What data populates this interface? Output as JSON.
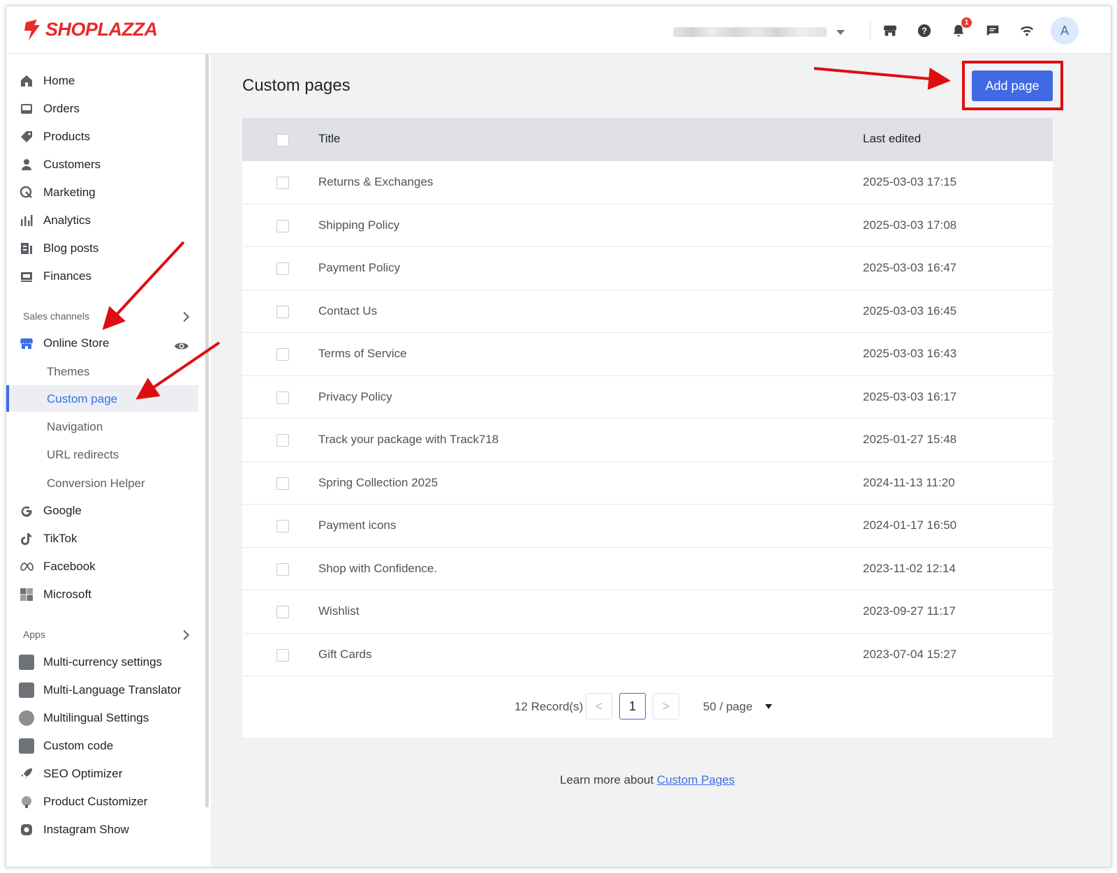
{
  "brand": {
    "name": "SHOPLAZZA",
    "color": "#e8292b"
  },
  "header": {
    "icons": [
      "storefront-icon",
      "help-icon",
      "bell-icon",
      "chat-icon",
      "wifi-icon"
    ],
    "notification_count": "1",
    "avatar_letter": "A"
  },
  "sidebar": {
    "main_items": [
      {
        "label": "Home",
        "icon": "home-icon"
      },
      {
        "label": "Orders",
        "icon": "orders-icon"
      },
      {
        "label": "Products",
        "icon": "tag-icon"
      },
      {
        "label": "Customers",
        "icon": "person-icon"
      },
      {
        "label": "Marketing",
        "icon": "marketing-icon"
      },
      {
        "label": "Analytics",
        "icon": "analytics-icon"
      },
      {
        "label": "Blog posts",
        "icon": "blog-icon"
      },
      {
        "label": "Finances",
        "icon": "finances-icon"
      }
    ],
    "sales_channels_label": "Sales channels",
    "online_store_label": "Online Store",
    "online_store_sub": [
      {
        "label": "Themes"
      },
      {
        "label": "Custom page",
        "active": true
      },
      {
        "label": "Navigation"
      },
      {
        "label": "URL redirects"
      },
      {
        "label": "Conversion Helper"
      }
    ],
    "channels": [
      {
        "label": "Google",
        "icon": "google-icon"
      },
      {
        "label": "TikTok",
        "icon": "tiktok-icon"
      },
      {
        "label": "Facebook",
        "icon": "meta-icon"
      },
      {
        "label": "Microsoft",
        "icon": "microsoft-icon"
      }
    ],
    "apps_label": "Apps",
    "apps": [
      {
        "label": "Multi-currency settings"
      },
      {
        "label": "Multi-Language Translator"
      },
      {
        "label": "Multilingual Settings"
      },
      {
        "label": "Custom code"
      },
      {
        "label": "SEO Optimizer"
      },
      {
        "label": "Product Customizer"
      },
      {
        "label": "Instagram Show"
      }
    ],
    "accent_color": "#3a6fe8"
  },
  "main": {
    "title": "Custom pages",
    "add_button_label": "Add page",
    "table": {
      "columns": [
        "Title",
        "Last edited"
      ],
      "rows": [
        {
          "title": "Returns & Exchanges",
          "edited": "2025-03-03 17:15"
        },
        {
          "title": "Shipping Policy",
          "edited": "2025-03-03 17:08"
        },
        {
          "title": "Payment Policy",
          "edited": "2025-03-03 16:47"
        },
        {
          "title": "Contact Us",
          "edited": "2025-03-03 16:45"
        },
        {
          "title": "Terms of Service",
          "edited": "2025-03-03 16:43"
        },
        {
          "title": "Privacy Policy",
          "edited": "2025-03-03 16:17"
        },
        {
          "title": "Track your package with Track718",
          "edited": "2025-01-27 15:48"
        },
        {
          "title": "Spring Collection 2025",
          "edited": "2024-11-13 11:20"
        },
        {
          "title": "Payment icons",
          "edited": "2024-01-17 16:50"
        },
        {
          "title": "Shop with Confidence.",
          "edited": "2023-11-02 12:14"
        },
        {
          "title": "Wishlist",
          "edited": "2023-09-27 11:17"
        },
        {
          "title": "Gift Cards",
          "edited": "2023-07-04 15:27"
        }
      ]
    },
    "pagination": {
      "records": "12 Record(s)",
      "current_page": "1",
      "prev": "<",
      "next": ">",
      "per_page": "50 / page"
    },
    "learn_more_prefix": "Learn more about ",
    "learn_more_link": "Custom Pages",
    "primary_color": "#4169e1",
    "annotation_color": "#e00d10"
  }
}
